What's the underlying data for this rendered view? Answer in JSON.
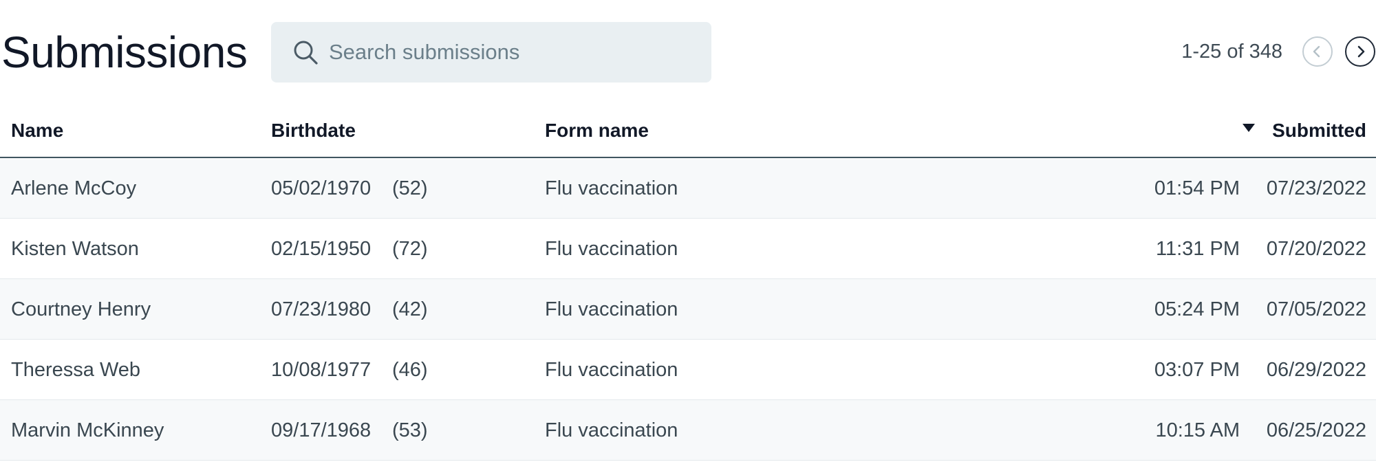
{
  "header": {
    "title": "Submissions",
    "search": {
      "placeholder": "Search submissions",
      "value": ""
    },
    "pagination": {
      "range_text": "1-25 of 348"
    }
  },
  "icons": {
    "search": "search-icon",
    "prev": "chevron-left-icon",
    "next": "chevron-right-icon",
    "sort": "sort-descending-icon"
  },
  "colors": {
    "search_bg": "#e9eff2",
    "header_rule": "#3f5560",
    "row_alt_bg": "#f7f9fa"
  },
  "table": {
    "columns": {
      "name": "Name",
      "birthdate": "Birthdate",
      "form_name": "Form name",
      "submitted": "Submitted"
    },
    "sort": {
      "column": "submitted",
      "direction": "descending"
    },
    "rows": [
      {
        "name": "Arlene McCoy",
        "birthdate": "05/02/1970",
        "age": "(52)",
        "form_name": "Flu vaccination",
        "time": "01:54 PM",
        "date": "07/23/2022"
      },
      {
        "name": "Kisten Watson",
        "birthdate": "02/15/1950",
        "age": "(72)",
        "form_name": "Flu vaccination",
        "time": "11:31 PM",
        "date": "07/20/2022"
      },
      {
        "name": "Courtney Henry",
        "birthdate": "07/23/1980",
        "age": "(42)",
        "form_name": "Flu vaccination",
        "time": "05:24 PM",
        "date": "07/05/2022"
      },
      {
        "name": "Theressa Web",
        "birthdate": "10/08/1977",
        "age": "(46)",
        "form_name": "Flu vaccination",
        "time": "03:07 PM",
        "date": "06/29/2022"
      },
      {
        "name": "Marvin McKinney",
        "birthdate": "09/17/1968",
        "age": "(53)",
        "form_name": "Flu vaccination",
        "time": "10:15 AM",
        "date": "06/25/2022"
      }
    ]
  }
}
